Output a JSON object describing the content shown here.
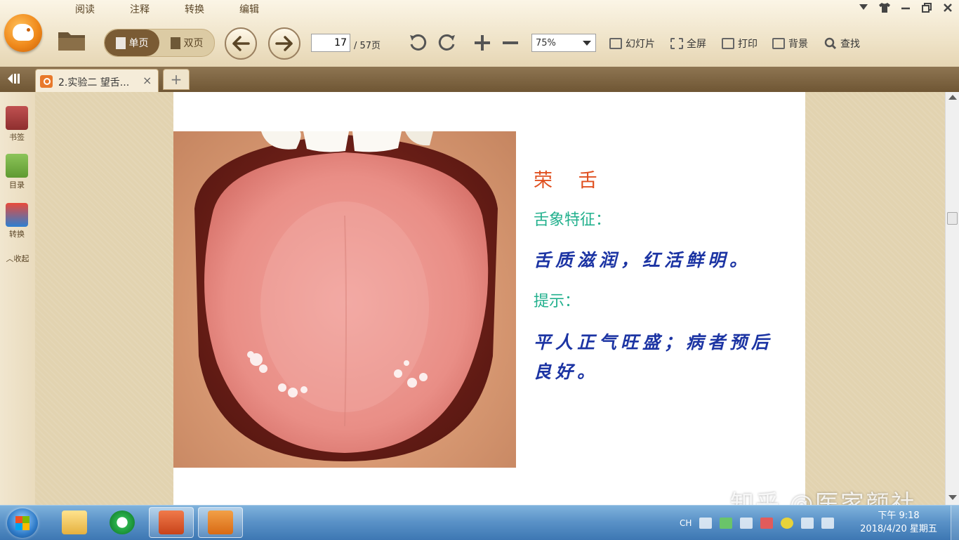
{
  "menu_tabs": [
    "阅读",
    "注释",
    "转换",
    "编辑"
  ],
  "view_modes": {
    "single": "单页",
    "double": "双页"
  },
  "pagination": {
    "current": "17",
    "total": "/ 57页"
  },
  "zoom": "75%",
  "toolbar_buttons": {
    "slideshow": "幻灯片",
    "fullscreen": "全屏",
    "print": "打印",
    "background": "背景",
    "find": "查找"
  },
  "document_tab": {
    "title": "2.实验二 望舌...",
    "close": "×",
    "new_tab": "+"
  },
  "sidebar": {
    "bookmark": "书签",
    "toc": "目录",
    "convert": "转换",
    "collapse": "︿收起"
  },
  "slide": {
    "title": "荣 舌",
    "feature_label": "舌象特征：",
    "feature_text": "舌质滋润，红活鲜明。",
    "hint_label": "提示：",
    "hint_text": "平人正气旺盛；病者预后良好。"
  },
  "watermark": "知乎 @医家颜社",
  "taskbar": {
    "lang": "CH",
    "time": "下午 9:18",
    "date": "2018/4/20 星期五"
  },
  "colors": {
    "title_red": "#e05020",
    "label_teal": "#22b08d",
    "body_blue": "#1c34a3",
    "toolbar_bg": "#efe3c8",
    "tabstrip_bg": "#7d6442"
  }
}
